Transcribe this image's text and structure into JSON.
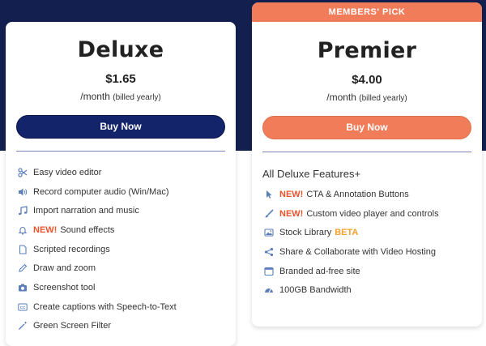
{
  "deluxe": {
    "name": "Deluxe",
    "price": "$1.65",
    "period": "/month",
    "billed": "(billed yearly)",
    "buy_label": "Buy Now",
    "features": [
      {
        "icon": "scissors-icon",
        "new": "",
        "text": "Easy video editor",
        "beta": ""
      },
      {
        "icon": "speaker-icon",
        "new": "",
        "text": "Record computer audio (Win/Mac)",
        "beta": ""
      },
      {
        "icon": "music-note-icon",
        "new": "",
        "text": "Import narration and music",
        "beta": ""
      },
      {
        "icon": "bell-icon",
        "new": "NEW!",
        "text": "Sound effects",
        "beta": ""
      },
      {
        "icon": "document-icon",
        "new": "",
        "text": "Scripted recordings",
        "beta": ""
      },
      {
        "icon": "pencil-icon",
        "new": "",
        "text": "Draw and zoom",
        "beta": ""
      },
      {
        "icon": "camera-icon",
        "new": "",
        "text": "Screenshot tool",
        "beta": ""
      },
      {
        "icon": "captions-icon",
        "new": "",
        "text": "Create captions with Speech-to-Text",
        "beta": ""
      },
      {
        "icon": "magic-wand-icon",
        "new": "",
        "text": "Green Screen Filter",
        "beta": ""
      }
    ]
  },
  "premier": {
    "badge": "MEMBERS' PICK",
    "name": "Premier",
    "price": "$4.00",
    "period": "/month",
    "billed": "(billed yearly)",
    "buy_label": "Buy Now",
    "all_deluxe": "All Deluxe Features+",
    "features": [
      {
        "icon": "cursor-icon",
        "new": "NEW!",
        "text": "CTA & Annotation Buttons",
        "beta": ""
      },
      {
        "icon": "brush-icon",
        "new": "NEW!",
        "text": "Custom video player and controls",
        "beta": ""
      },
      {
        "icon": "image-icon",
        "new": "",
        "text": "Stock Library",
        "beta": "BETA"
      },
      {
        "icon": "share-icon",
        "new": "",
        "text": "Share & Collaborate with Video Hosting",
        "beta": ""
      },
      {
        "icon": "browser-window-icon",
        "new": "",
        "text": "Branded ad-free site",
        "beta": ""
      },
      {
        "icon": "speedometer-icon",
        "new": "",
        "text": "100GB Bandwidth",
        "beta": ""
      }
    ]
  },
  "colors": {
    "header_band": "#13204f",
    "deluxe_button": "#13246b",
    "premier_accent": "#f17c5a",
    "new_text": "#e8542e",
    "beta_text": "#f2a12a",
    "icon": "#5b7fb9"
  }
}
